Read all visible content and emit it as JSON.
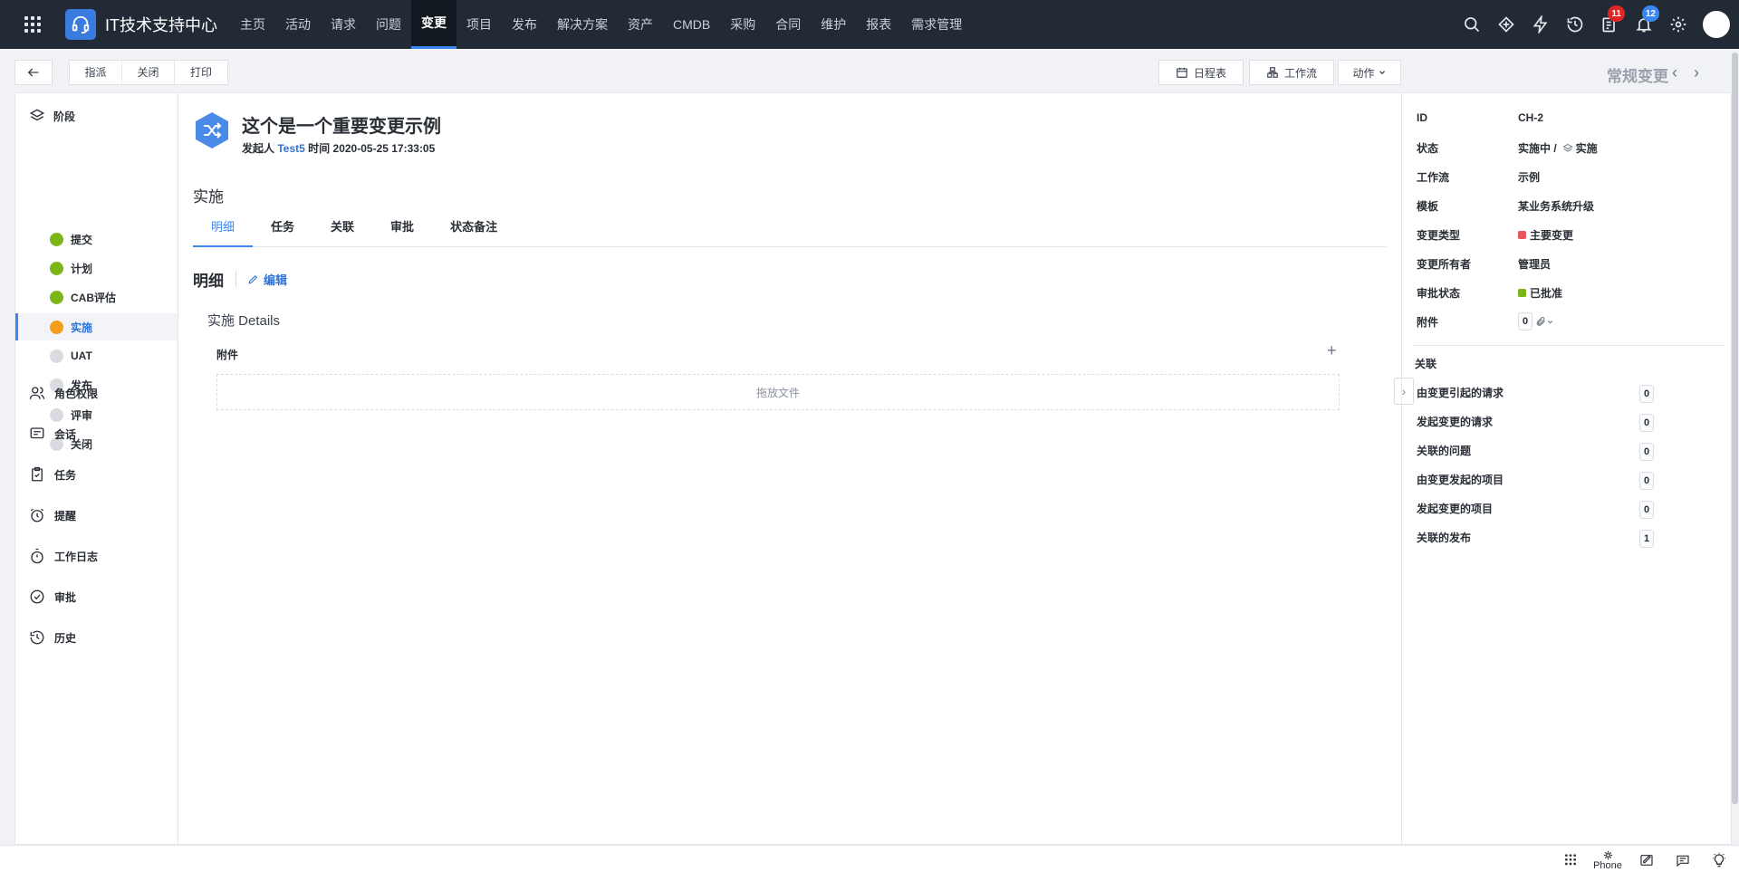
{
  "app": {
    "title": "IT技术支持中心"
  },
  "nav": {
    "items": [
      "主页",
      "活动",
      "请求",
      "问题",
      "变更",
      "项目",
      "发布",
      "解决方案",
      "资产",
      "CMDB",
      "采购",
      "合同",
      "维护",
      "报表",
      "需求管理"
    ],
    "active_index": 4,
    "badges": {
      "tasks": "11",
      "notifications": "12"
    }
  },
  "toolbar": {
    "assign": "指派",
    "close": "关闭",
    "print": "打印",
    "calendar": "日程表",
    "workflow": "工作流",
    "actions": "动作",
    "change_type_title": "常规变更"
  },
  "stages": {
    "header": "阶段",
    "items": [
      {
        "label": "提交",
        "status": "done"
      },
      {
        "label": "计划",
        "status": "done"
      },
      {
        "label": "CAB评估",
        "status": "done"
      },
      {
        "label": "实施",
        "status": "current"
      },
      {
        "label": "UAT",
        "status": "pending"
      },
      {
        "label": "发布",
        "status": "pending"
      },
      {
        "label": "评审",
        "status": "pending"
      },
      {
        "label": "关闭",
        "status": "pending"
      }
    ],
    "colors": {
      "done": "#7cb518",
      "current": "#f59c1a",
      "pending": "#d8dbe0"
    }
  },
  "side_menu": [
    "角色权限",
    "会话",
    "任务",
    "提醒",
    "工作日志",
    "审批",
    "历史"
  ],
  "change": {
    "title": "这个是一个重要变更示例",
    "requester_label": "发起人",
    "requester": "Test5",
    "time_label": "时间",
    "time": "2020-05-25 17:33:05",
    "phase": "实施"
  },
  "tabs": [
    "明细",
    "任务",
    "关联",
    "审批",
    "状态备注"
  ],
  "details": {
    "section_title": "明细",
    "edit": "编辑",
    "panel_title": "实施 Details",
    "attachments_label": "附件",
    "add_icon": "+",
    "dropzone": "拖放文件"
  },
  "properties": {
    "id_label": "ID",
    "id": "CH-2",
    "status_label": "状态",
    "status": "实施中 /",
    "status_stage": "实施",
    "workflow_label": "工作流",
    "workflow": "示例",
    "template_label": "模板",
    "template": "某业务系统升级",
    "type_label": "变更类型",
    "type": "主要变更",
    "type_color": "#e8585a",
    "owner_label": "变更所有者",
    "owner": "管理员",
    "approval_label": "审批状态",
    "approval": "已批准",
    "approval_color": "#7cb518",
    "attachments_label": "附件",
    "attachments": "0"
  },
  "relations": {
    "header": "关联",
    "items": [
      {
        "label": "由变更引起的请求",
        "count": "0"
      },
      {
        "label": "发起变更的请求",
        "count": "0"
      },
      {
        "label": "关联的问题",
        "count": "0"
      },
      {
        "label": "由变更发起的项目",
        "count": "0"
      },
      {
        "label": "发起变更的项目",
        "count": "0"
      },
      {
        "label": "关联的发布",
        "count": "1"
      }
    ]
  },
  "bottom": {
    "phone": "Phone"
  }
}
